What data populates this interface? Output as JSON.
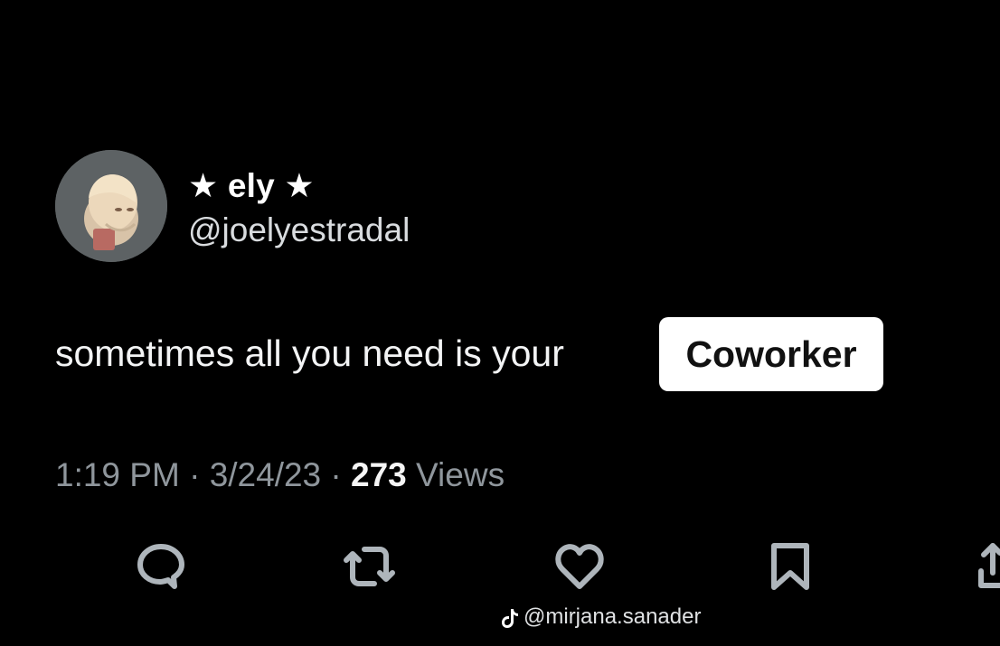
{
  "tweet": {
    "display_name": "★ ely ★",
    "handle": "@joelyestradal",
    "text_prefix": "sometimes all you need is your",
    "highlighted_word": "Coworker",
    "time": "1:19 PM",
    "separator": "·",
    "date": "3/24/23",
    "views_count": "273",
    "views_label": "Views"
  },
  "actions": [
    {
      "name": "reply",
      "icon": "speech-bubble-icon"
    },
    {
      "name": "retweet",
      "icon": "retweet-icon"
    },
    {
      "name": "like",
      "icon": "heart-icon"
    },
    {
      "name": "bookmark",
      "icon": "bookmark-icon"
    },
    {
      "name": "share",
      "icon": "share-icon"
    }
  ],
  "watermark": {
    "text": "@mirjana.sanader",
    "icon": "tiktok-icon"
  },
  "colors": {
    "background": "#000000",
    "text": "#ffffff",
    "secondary_text": "#8f969c",
    "highlight_bg": "#ffffff",
    "highlight_text": "#111111"
  }
}
